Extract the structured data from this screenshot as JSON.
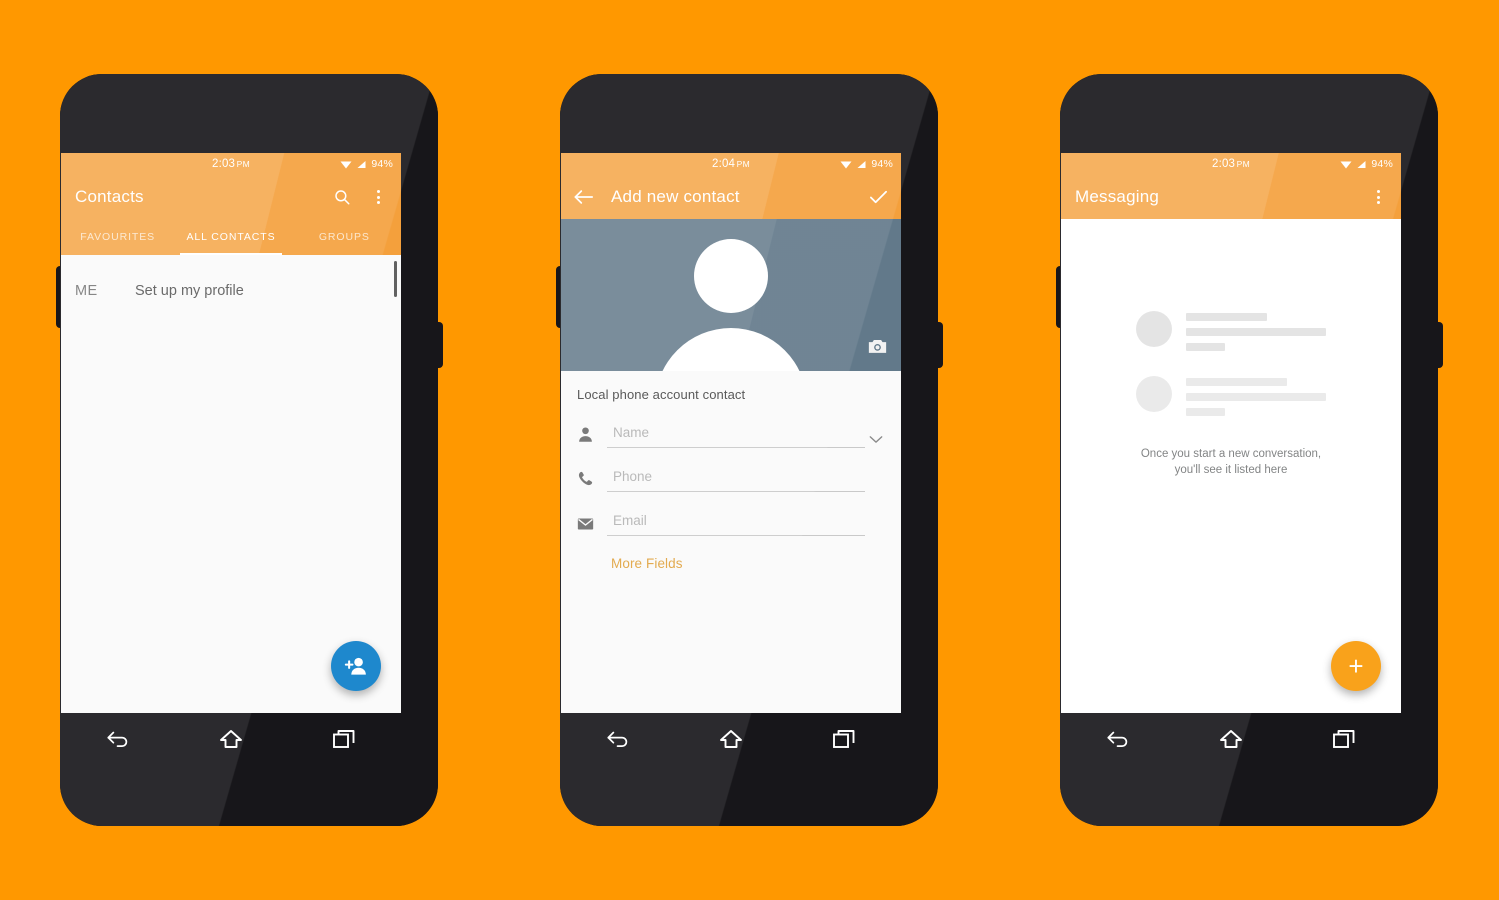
{
  "background_color": "#ff9800",
  "phones": [
    {
      "id": "contacts",
      "status": {
        "time": "2:03",
        "ampm": "PM",
        "battery": "94%"
      },
      "appbar": {
        "title": "Contacts",
        "search_icon": "search-icon",
        "overflow_icon": "overflow-menu-icon"
      },
      "tabs": [
        {
          "label": "FAVOURITES",
          "active": false
        },
        {
          "label": "ALL CONTACTS",
          "active": true
        },
        {
          "label": "GROUPS",
          "active": false
        }
      ],
      "list": {
        "me_label": "ME",
        "me_text": "Set up my profile"
      },
      "fab": {
        "color": "#1e88cd",
        "icon": "add-person-icon"
      },
      "nav": [
        "back-icon",
        "home-icon",
        "recents-icon"
      ]
    },
    {
      "id": "add-contact",
      "status": {
        "time": "2:04",
        "ampm": "PM",
        "battery": "94%"
      },
      "appbar": {
        "back_icon": "back-arrow-icon",
        "title": "Add new contact",
        "confirm_icon": "check-icon"
      },
      "photo": {
        "camera_icon": "camera-icon",
        "bg_color": "#62798a"
      },
      "form": {
        "account_line": "Local phone account contact",
        "fields": [
          {
            "icon": "person-icon",
            "placeholder": "Name",
            "value": "",
            "has_chevron": true
          },
          {
            "icon": "phone-icon",
            "placeholder": "Phone",
            "value": "",
            "has_chevron": false
          },
          {
            "icon": "email-icon",
            "placeholder": "Email",
            "value": "",
            "has_chevron": false
          }
        ],
        "more_fields_label": "More Fields",
        "more_fields_color": "#e0a33f"
      },
      "nav": [
        "back-icon",
        "home-icon",
        "recents-icon"
      ]
    },
    {
      "id": "messaging",
      "status": {
        "time": "2:03",
        "ampm": "PM",
        "battery": "94%"
      },
      "appbar": {
        "title": "Messaging",
        "overflow_icon": "overflow-menu-icon"
      },
      "empty_state": {
        "line1": "Once you start a new conversation,",
        "line2": "you'll see it listed here"
      },
      "fab": {
        "color": "#f9a21b",
        "icon": "plus-icon",
        "glyph": "+"
      },
      "nav": [
        "back-icon",
        "home-icon",
        "recents-icon"
      ]
    }
  ]
}
